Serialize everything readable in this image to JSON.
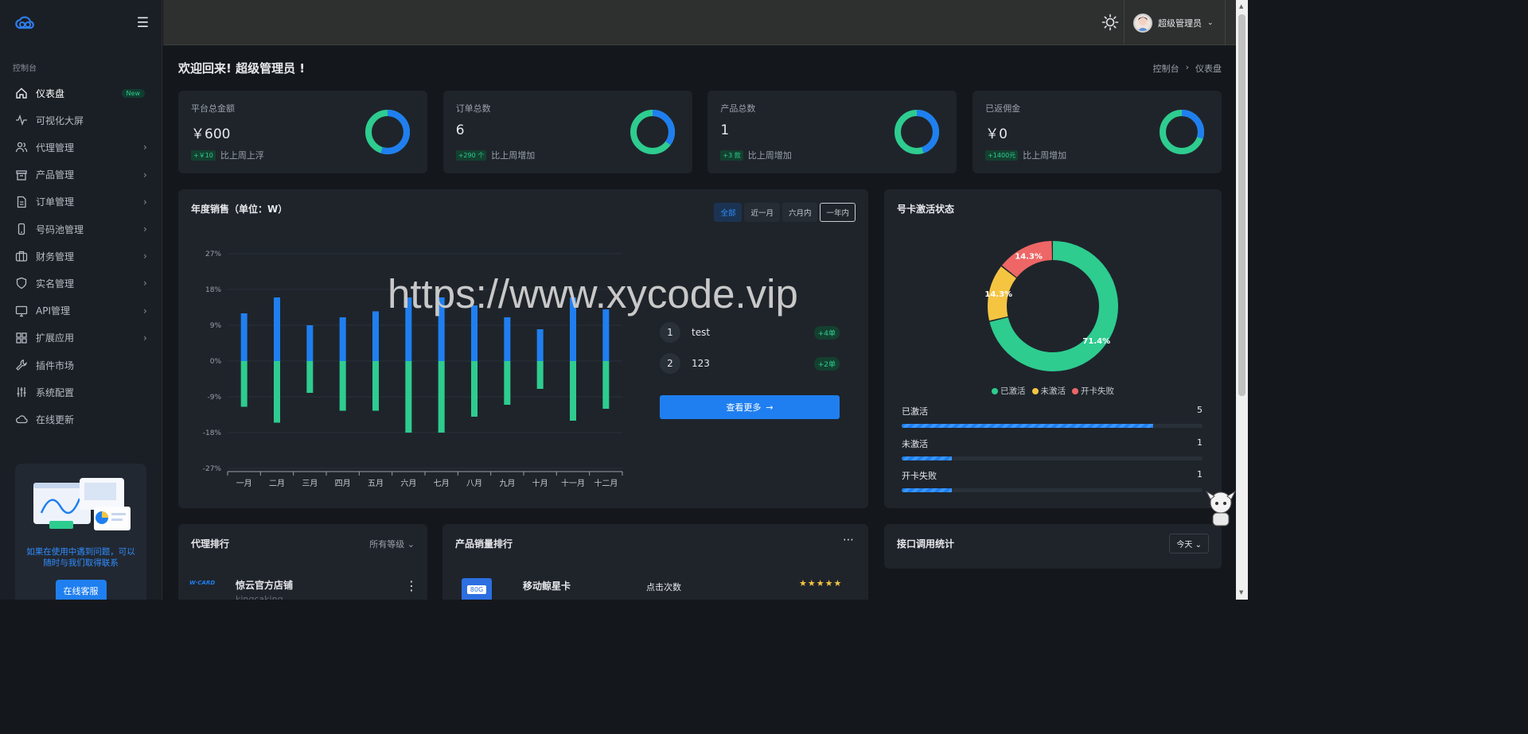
{
  "sidebar": {
    "group_label": "控制台",
    "items": [
      {
        "label": "仪表盘",
        "icon": "home-icon",
        "active": true,
        "badge": "New"
      },
      {
        "label": "可视化大屏",
        "icon": "pulse-icon"
      },
      {
        "label": "代理管理",
        "icon": "users-icon",
        "has_children": true
      },
      {
        "label": "产品管理",
        "icon": "box-icon",
        "has_children": true
      },
      {
        "label": "订单管理",
        "icon": "document-icon",
        "has_children": true
      },
      {
        "label": "号码池管理",
        "icon": "phone-icon",
        "has_children": true
      },
      {
        "label": "财务管理",
        "icon": "briefcase-icon",
        "has_children": true
      },
      {
        "label": "实名管理",
        "icon": "shield-icon",
        "has_children": true
      },
      {
        "label": "API管理",
        "icon": "monitor-icon",
        "has_children": true
      },
      {
        "label": "扩展应用",
        "icon": "grid-icon",
        "has_children": true
      },
      {
        "label": "插件市场",
        "icon": "wrench-icon"
      },
      {
        "label": "系统配置",
        "icon": "sliders-icon"
      },
      {
        "label": "在线更新",
        "icon": "cloud-icon"
      }
    ],
    "help": {
      "text": "如果在使用中遇到问题，可以随时与我们取得联系",
      "button": "在线客服"
    }
  },
  "header": {
    "user_name": "超级管理员"
  },
  "page": {
    "welcome": "欢迎回来! 超级管理员 !",
    "breadcrumb": [
      "控制台",
      "仪表盘"
    ]
  },
  "stats": [
    {
      "label": "平台总金额",
      "value": "￥600",
      "delta": "+￥10",
      "foot": "比上周上浮",
      "ring": 0.55
    },
    {
      "label": "订单总数",
      "value": "6",
      "delta": "+290 个",
      "foot": "比上周增加",
      "ring": 0.35
    },
    {
      "label": "产品总数",
      "value": "1",
      "delta": "+3 款",
      "foot": "比上周增加",
      "ring": 0.45
    },
    {
      "label": "已返佣金",
      "value": "￥0",
      "delta": "+1400元",
      "foot": "比上周增加",
      "ring": 0.3
    }
  ],
  "sales": {
    "title": "年度销售（单位：W）",
    "filters": [
      "全部",
      "近一月",
      "六月内",
      "一年内"
    ],
    "ranking": [
      {
        "rank": "1",
        "name": "test",
        "delta": "+4单"
      },
      {
        "rank": "2",
        "name": "123",
        "delta": "+2单"
      }
    ],
    "more_button": "查看更多"
  },
  "chart_data": {
    "type": "bar",
    "categories": [
      "一月",
      "二月",
      "三月",
      "四月",
      "五月",
      "六月",
      "七月",
      "八月",
      "九月",
      "十月",
      "十一月",
      "十二月"
    ],
    "y_ticks": [
      "27%",
      "18%",
      "9%",
      "0%",
      "-9%",
      "-18%",
      "-27%"
    ],
    "ylim": [
      -27,
      27
    ],
    "series": [
      {
        "color": "#1f7ff0",
        "values": [
          12,
          16,
          9,
          11,
          12.5,
          16,
          16,
          14,
          11,
          8,
          16,
          13
        ]
      },
      {
        "color": "#2ecc8f",
        "values": [
          -11.5,
          -15.5,
          -8,
          -12.5,
          -12.5,
          -18,
          -18,
          -14,
          -11,
          -7,
          -15,
          -12
        ]
      }
    ]
  },
  "activation": {
    "title": "号卡激活状态",
    "donut": [
      {
        "name": "已激活",
        "percent": 71.4,
        "label": "71.4%",
        "color": "#2ecc8f"
      },
      {
        "name": "未激活",
        "percent": 14.3,
        "label": "14.3%",
        "color": "#f5c542"
      },
      {
        "name": "开卡失败",
        "percent": 14.3,
        "label": "14.3%",
        "color": "#ee6666"
      }
    ],
    "bars": [
      {
        "name": "已激活",
        "count": "5",
        "fraction": 0.835
      },
      {
        "name": "未激活",
        "count": "1",
        "fraction": 0.167
      },
      {
        "name": "开卡失败",
        "count": "1",
        "fraction": 0.167
      }
    ]
  },
  "agent_rank": {
    "title": "代理排行",
    "filter": "所有等级",
    "first": {
      "logo": "W·CARD",
      "name": "惊云官方店铺",
      "sub": "kingcaking"
    }
  },
  "product_rank": {
    "title": "产品销量排行",
    "first": {
      "image_text": "80G",
      "name": "移动鲸星卡",
      "metric": "点击次数"
    }
  },
  "api_stats": {
    "title": "接口调用统计",
    "filter": "今天"
  },
  "watermark": "https://www.xycode.vip"
}
